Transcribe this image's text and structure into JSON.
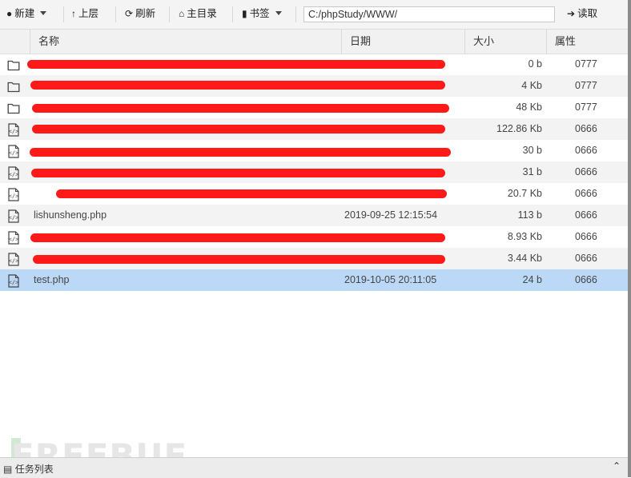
{
  "toolbar": {
    "new_label": "新建",
    "up_label": "上层",
    "refresh_label": "刷新",
    "home_label": "主目录",
    "bookmark_label": "书签",
    "path_value": "C:/phpStudy/WWW/",
    "read_label": "读取"
  },
  "columns": {
    "name": "名称",
    "date": "日期",
    "size": "大小",
    "attr": "属性"
  },
  "files": [
    {
      "type": "folder",
      "name": "",
      "date": "",
      "size": "0 b",
      "perm": "0777",
      "redacted": true
    },
    {
      "type": "folder",
      "name": "",
      "date": "",
      "size": "4 Kb",
      "perm": "0777",
      "redacted": true
    },
    {
      "type": "folder",
      "name": "",
      "date": "",
      "size": "48 Kb",
      "perm": "0777",
      "redacted": true
    },
    {
      "type": "file",
      "name": "",
      "date": "",
      "size": "122.86 Kb",
      "perm": "0666",
      "redacted": true
    },
    {
      "type": "file",
      "name": "",
      "date": "",
      "size": "30 b",
      "perm": "0666",
      "redacted": true
    },
    {
      "type": "file",
      "name": "",
      "date": "",
      "size": "31 b",
      "perm": "0666",
      "redacted": true
    },
    {
      "type": "file",
      "name": "",
      "date": "",
      "size": "20.7 Kb",
      "perm": "0666",
      "redacted": true
    },
    {
      "type": "file",
      "name": "lishunsheng.php",
      "date": "2019-09-25 12:15:54",
      "size": "113 b",
      "perm": "0666",
      "redacted": false
    },
    {
      "type": "file",
      "name": "",
      "date": "",
      "size": "8.93 Kb",
      "perm": "0666",
      "redacted": true
    },
    {
      "type": "file",
      "name": "",
      "date": "",
      "size": "3.44 Kb",
      "perm": "0666",
      "redacted": true
    },
    {
      "type": "file",
      "name": "test.php",
      "date": "2019-10-05 20:11:05",
      "size": "24 b",
      "perm": "0666",
      "redacted": false,
      "selected": true
    }
  ],
  "taskbar": {
    "label": "任务列表",
    "collapse_icon": "chevron-up-icon"
  },
  "watermark": "FREEBUF",
  "colors": {
    "selected_row": "#bcd8f7",
    "redaction": "#ff1a1a"
  }
}
